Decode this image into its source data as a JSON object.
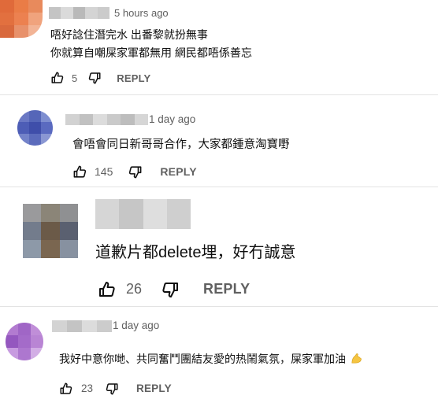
{
  "colors": {
    "text": "#0f0f0f",
    "secondary_text": "#606060",
    "divider": "#e3e3e3",
    "emoji_arm": "#f5c542"
  },
  "icons": {
    "like": "thumbs-up-icon",
    "dislike": "thumbs-down-icon",
    "emoji": "flexed-biceps-emoji"
  },
  "comments": [
    {
      "timestamp": "5 hours ago",
      "lines": [
        "唔好諗住潛完水 出番黎就扮無事",
        "你就算自嘲屎家軍都無用 網民都唔係善忘"
      ],
      "likes": "5",
      "reply_label": "REPLY"
    },
    {
      "timestamp": "1 day ago",
      "lines": [
        "會唔會同日新哥哥合作，大家都鍾意淘寶嘢"
      ],
      "likes": "145",
      "reply_label": "REPLY"
    },
    {
      "lines": [
        "道歉片都delete埋，好冇誠意"
      ],
      "likes": "26",
      "reply_label": "REPLY"
    },
    {
      "timestamp": "1 day ago",
      "lines": [
        "我好中意你哋、共同奮鬥團結友愛的热鬧氣氛，屎家軍加油"
      ],
      "likes": "23",
      "reply_label": "REPLY"
    }
  ]
}
